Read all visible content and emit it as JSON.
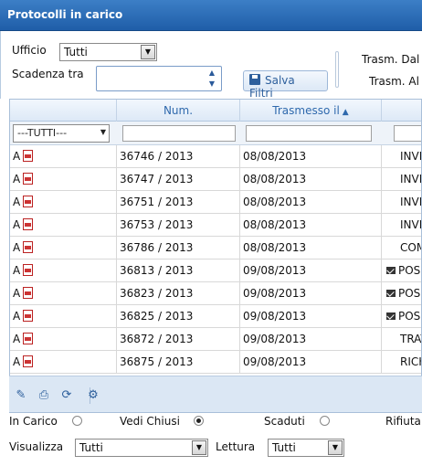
{
  "panel": {
    "title": "Protocolli in carico"
  },
  "filters": {
    "ufficio_label": "Ufficio",
    "ufficio_value": "Tutti",
    "scadenza_label": "Scadenza tra",
    "scadenza_value": "",
    "salva_filtri_label": "Salva Filtri",
    "trasm_dal_label": "Trasm. Dal",
    "trasm_al_label": "Trasm. Al"
  },
  "grid": {
    "columns": {
      "tipo": "",
      "num": "Num.",
      "trasmesso": "Trasmesso il",
      "oggetto": ""
    },
    "tipo_filter": "---TUTTI---",
    "rows": [
      {
        "tipo": "A",
        "num": "36746 / 2013",
        "trasmesso": "08/08/2013",
        "oggetto": "INVI",
        "mail": false
      },
      {
        "tipo": "A",
        "num": "36747 / 2013",
        "trasmesso": "08/08/2013",
        "oggetto": "INVI",
        "mail": false
      },
      {
        "tipo": "A",
        "num": "36751 / 2013",
        "trasmesso": "08/08/2013",
        "oggetto": "INVI",
        "mail": false
      },
      {
        "tipo": "A",
        "num": "36753 / 2013",
        "trasmesso": "08/08/2013",
        "oggetto": "INVI",
        "mail": false
      },
      {
        "tipo": "A",
        "num": "36786 / 2013",
        "trasmesso": "08/08/2013",
        "oggetto": "COM",
        "mail": false
      },
      {
        "tipo": "A",
        "num": "36813 / 2013",
        "trasmesso": "09/08/2013",
        "oggetto": "POS",
        "mail": true
      },
      {
        "tipo": "A",
        "num": "36823 / 2013",
        "trasmesso": "09/08/2013",
        "oggetto": "POS",
        "mail": true
      },
      {
        "tipo": "A",
        "num": "36825 / 2013",
        "trasmesso": "09/08/2013",
        "oggetto": "POS",
        "mail": true
      },
      {
        "tipo": "A",
        "num": "36872 / 2013",
        "trasmesso": "09/08/2013",
        "oggetto": "TRAT",
        "mail": false
      },
      {
        "tipo": "A",
        "num": "36875 / 2013",
        "trasmesso": "09/08/2013",
        "oggetto": "RICH",
        "mail": false
      }
    ]
  },
  "toolbar": {
    "icons": [
      "pencil-icon",
      "print-icon",
      "refresh-icon",
      "gear-icon"
    ]
  },
  "bottom": {
    "in_carico_label": "In Carico",
    "vedi_chiusi_label": "Vedi Chiusi",
    "scaduti_label": "Scaduti",
    "rifiutati_label": "Rifiuta",
    "visualizza_label": "Visualizza",
    "visualizza_value": "Tutti",
    "lettura_label": "Lettura",
    "lettura_value": "Tutti",
    "selected_radio": "vedi_chiusi"
  }
}
